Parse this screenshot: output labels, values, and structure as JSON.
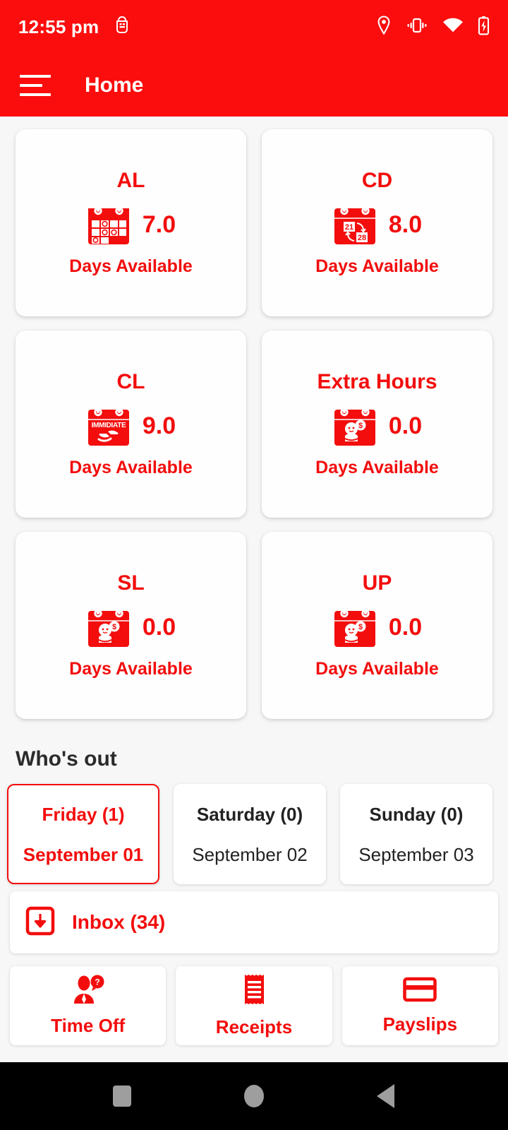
{
  "status_bar": {
    "time": "12:55 pm",
    "icons": [
      "android-debug-icon",
      "location-pin-icon",
      "vibrate-icon",
      "wifi-icon",
      "battery-charging-icon"
    ],
    "background": "#fb0d0d"
  },
  "app_bar": {
    "menu_icon": "hamburger-menu-icon",
    "title": "Home",
    "background": "#fb0d0d"
  },
  "theme": {
    "accent": "#f30d0d",
    "page_background": "#f7f7f7",
    "card_background": "#ffffff",
    "text_dark": "#222222"
  },
  "balances": [
    {
      "code": "AL",
      "value": "7.0",
      "subtitle": "Days Available",
      "icon": "calendar-grid-icon"
    },
    {
      "code": "CD",
      "value": "8.0",
      "subtitle": "Days Available",
      "icon": "calendar-reschedule-icon",
      "icon_labels": [
        "21",
        "28"
      ]
    },
    {
      "code": "CL",
      "value": "9.0",
      "subtitle": "Days Available",
      "icon": "calendar-immidiate-hands-icon",
      "icon_labels": [
        "IMMIDIATE"
      ]
    },
    {
      "code": "Extra Hours",
      "value": "0.0",
      "subtitle": "Days Available",
      "icon": "calendar-baby-money-icon"
    },
    {
      "code": "SL",
      "value": "0.0",
      "subtitle": "Days Available",
      "icon": "calendar-baby-money-icon"
    },
    {
      "code": "UP",
      "value": "0.0",
      "subtitle": "Days Available",
      "icon": "calendar-baby-money-icon"
    }
  ],
  "whos_out": {
    "heading": "Who's out",
    "days": [
      {
        "day": "Friday (1)",
        "date": "September 01",
        "selected": true
      },
      {
        "day": "Saturday (0)",
        "date": "September 02",
        "selected": false
      },
      {
        "day": "Sunday (0)",
        "date": "September 03",
        "selected": false
      }
    ]
  },
  "inbox": {
    "icon": "inbox-download-icon",
    "label": "Inbox (34)",
    "count": 34
  },
  "actions": [
    {
      "label": "Time Off",
      "icon": "person-question-icon"
    },
    {
      "label": "Receipts",
      "icon": "receipt-icon"
    },
    {
      "label": "Payslips",
      "icon": "payment-card-icon"
    }
  ],
  "nav_bar": {
    "buttons": [
      "recents-square-icon",
      "home-circle-icon",
      "back-triangle-icon"
    ],
    "background": "#000000"
  }
}
